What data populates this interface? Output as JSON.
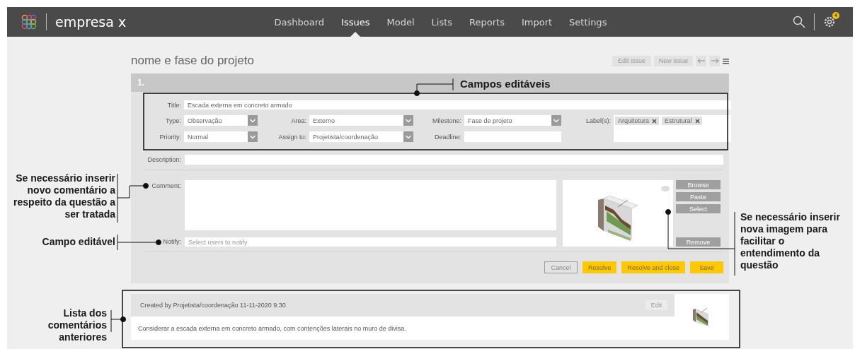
{
  "nav": {
    "brand": "empresa x",
    "items": [
      {
        "label": "Dashboard",
        "selected": false
      },
      {
        "label": "Issues",
        "selected": true
      },
      {
        "label": "Model",
        "selected": false
      },
      {
        "label": "Lists",
        "selected": false
      },
      {
        "label": "Reports",
        "selected": false
      },
      {
        "label": "Import",
        "selected": false
      },
      {
        "label": "Settings",
        "selected": false
      }
    ],
    "notification_count": "4"
  },
  "page_title": "nome e fase do projeto",
  "toolbar": [
    {
      "label": "Edit issue",
      "disabled": true
    },
    {
      "label": "New issue",
      "disabled": true
    }
  ],
  "issue": {
    "number": "1.",
    "title_field": {
      "label": "Title:",
      "value": "Escada externa em concreto armado"
    },
    "fields": [
      {
        "label": "Type:",
        "kind": "select",
        "value": "Observação"
      },
      {
        "label": "Area:",
        "kind": "select",
        "value": "Externo"
      },
      {
        "label": "Milestone:",
        "kind": "select",
        "value": "Fase de projeto"
      },
      {
        "label": "Priority:",
        "kind": "select",
        "value": "Normal"
      },
      {
        "label": "Assign to:",
        "kind": "select",
        "value": "Projetista/coordenação"
      },
      {
        "label": "Deadline:",
        "kind": "text"
      }
    ],
    "labels_field": {
      "label": "Label(s):",
      "tags": [
        "Arquitetura",
        "Estrutural"
      ]
    },
    "description": {
      "label": "Description:"
    },
    "comment": {
      "label": "Comment:"
    },
    "notify": {
      "label": "Notify:",
      "placeholder": "Select users to notify"
    },
    "image_buttons": [
      "Browse",
      "Paste",
      "Select"
    ],
    "remove_button": "Remove",
    "actions": [
      {
        "label": "Cancel",
        "kind": "secondary"
      },
      {
        "label": "Resolve",
        "kind": "primary"
      },
      {
        "label": "Resolve and close",
        "kind": "primary"
      },
      {
        "label": "Save",
        "kind": "primary"
      }
    ]
  },
  "comments": [
    {
      "meta": "Created by Projetista/coordenação 11-11-2020 9:30",
      "edit": "Edit",
      "text": "Considerar a escada externa em concreto armado, com contenções laterais no muro de divisa."
    }
  ],
  "annotations": [
    {
      "text": "Campos editáveis"
    },
    {
      "text": "Se necessário inserir\nnovo comentário a\nrespeito da questão a\nser tratada"
    },
    {
      "text": "Campo editável"
    },
    {
      "text": "Se necessário inserir\nnova imagem para\nfacilitar o\nentendimento da\nquestão"
    },
    {
      "text": "Lista dos\ncomentários\nanteriores"
    }
  ]
}
